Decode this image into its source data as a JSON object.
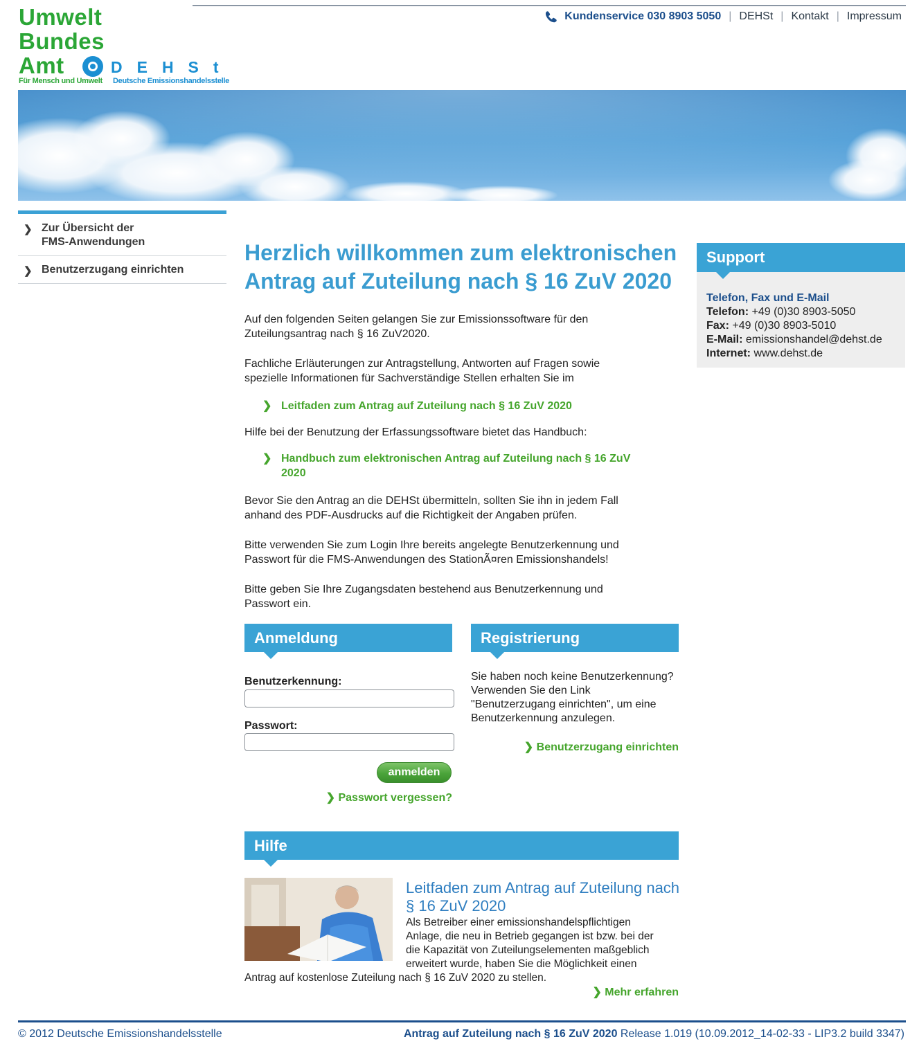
{
  "logo": {
    "line1": "Umwelt",
    "line2": "Bundes",
    "line3": "Amt",
    "dehst_letters": "DEHSt",
    "subtitle_uba": "Für Mensch und Umwelt",
    "subtitle_dehst": "Deutsche Emissionshandelsstelle"
  },
  "topnav": {
    "service": "Kundenservice 030 8903 5050",
    "items": [
      "DEHSt",
      "Kontakt",
      "Impressum"
    ]
  },
  "sidebar": {
    "items": [
      {
        "label_line1": "Zur Übersicht der",
        "label_line2": "FMS-Anwendungen"
      },
      {
        "label_line1": "Benutzerzugang einrichten",
        "label_line2": ""
      }
    ]
  },
  "main": {
    "title_line1": "Herzlich willkommen zum elektronischen",
    "title_line2": "Antrag auf Zuteilung nach § 16 ZuV 2020",
    "p1_line1": "Auf den folgenden Seiten gelangen Sie zur Emissionssoftware für den",
    "p1_line2": "Zuteilungsantrag nach § 16 ZuV2020.",
    "p2_line1": "Fachliche Erläuterungen zur Antragstellung, Antworten auf Fragen sowie",
    "p2_line2": "spezielle Informationen für Sachverständige Stellen erhalten Sie im",
    "link1": "Leitfaden zum Antrag auf Zuteilung nach § 16 ZuV 2020",
    "p3": "Hilfe bei der Benutzung der Erfassungssoftware bietet das Handbuch:",
    "link2_line1": "Handbuch zum elektronischen Antrag auf Zuteilung nach § 16 ZuV",
    "link2_line2": "2020",
    "p4_line1": "Bevor Sie den Antrag an die DEHSt übermitteln, sollten Sie ihn in jedem Fall",
    "p4_line2": "anhand des PDF-Ausdrucks auf die Richtigkeit der Angaben prüfen.",
    "p5_line1": "Bitte verwenden Sie zum Login Ihre bereits angelegte Benutzerkennung und",
    "p5_line2": "Passwort für die FMS-Anwendungen des StationÃ¤ren Emissionshandels!",
    "p6_line1": "Bitte geben Sie Ihre Zugangsdaten bestehend aus Benutzerkennung und",
    "p6_line2": "Passwort ein."
  },
  "login": {
    "heading": "Anmeldung",
    "user_label": "Benutzerkennung:",
    "user_value": "",
    "password_label": "Passwort:",
    "password_value": "",
    "submit": "anmelden",
    "forgot": "Passwort vergessen?"
  },
  "register": {
    "heading": "Registrierung",
    "text_line1": "Sie haben noch keine Benutzerkennung?",
    "text_line2": "Verwenden Sie den Link",
    "text_line3": "\"Benutzerzugang einrichten\", um eine",
    "text_line4": "Benutzerkennung anzulegen.",
    "link": "Benutzerzugang einrichten"
  },
  "support": {
    "heading": "Support",
    "subtitle": "Telefon, Fax und E-Mail",
    "phone_label": "Telefon:",
    "phone_value": "+49 (0)30 8903-5050",
    "fax_label": "Fax:",
    "fax_value": "+49 (0)30 8903-5010",
    "email_label": "E-Mail:",
    "email_value": "emissionshandel@dehst.de",
    "web_label": "Internet:",
    "web_value": "www.dehst.de"
  },
  "hilfe": {
    "heading": "Hilfe",
    "title_line1": "Leitfaden zum Antrag auf Zuteilung nach",
    "title_line2": "§ 16 ZuV 2020",
    "text_line1": "Als Betreiber einer emissionshandelspflichtigen",
    "text_line2": "Anlage, die neu in Betrieb gegangen ist bzw. bei der",
    "text_line3": "die Kapazität von Zuteilungselementen maßgeblich",
    "text_line4": "erweitert wurde, haben Sie die Möglichkeit einen",
    "text_line5": "Antrag auf kostenlose Zuteilung nach § 16 ZuV 2020 zu stellen.",
    "more": "Mehr erfahren"
  },
  "footer": {
    "copyright": "© 2012 Deutsche Emissionshandelsstelle",
    "app_name": "Antrag auf Zuteilung nach § 16 ZuV 2020",
    "release": " Release 1.019 (10.09.2012_14-02-33 - LIP3.2 build 3347)"
  },
  "icons": {
    "phone": "phone-icon",
    "chevron": "chevron-right-icon",
    "un_emblem": "un-emblem-icon"
  },
  "colors": {
    "accent_blue": "#3aa3d5",
    "link_green": "#45a52c",
    "dark_blue": "#1c4f8c",
    "logo_green": "#2ba636"
  }
}
